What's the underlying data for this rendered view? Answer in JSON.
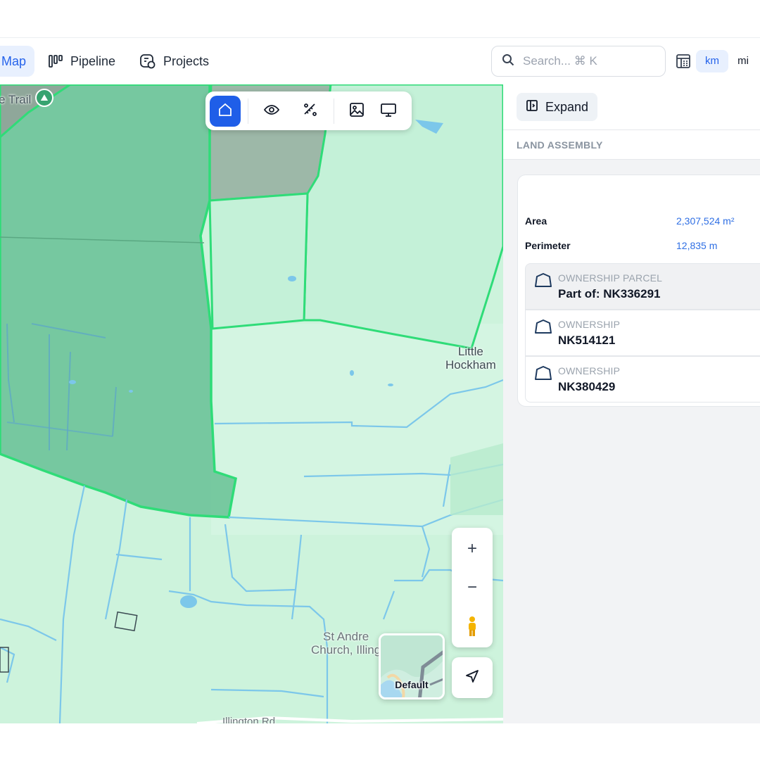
{
  "nav": {
    "items": [
      {
        "label": "Map",
        "icon": "map-icon",
        "active": true
      },
      {
        "label": "Pipeline",
        "icon": "pipeline-icon",
        "active": false
      },
      {
        "label": "Projects",
        "icon": "projects-icon",
        "active": false
      }
    ],
    "search": {
      "placeholder": "Search... ⌘ K",
      "value": ""
    },
    "units": {
      "km": "km",
      "mi": "mi",
      "active": "km"
    }
  },
  "map": {
    "labels": {
      "trail": "e Trail",
      "hockham": "Little\nHockham",
      "church": "St Andre\nChurch, Illing",
      "road": "Illington Rd"
    },
    "toolbar": [
      "home-icon",
      "eye-icon",
      "measure-icon",
      "image-icon",
      "monitor-icon"
    ],
    "zoom": {
      "in": "+",
      "out": "−"
    },
    "style_label": "Default"
  },
  "panel": {
    "expand_label": "Expand",
    "section_title": "LAND ASSEMBLY",
    "metrics": {
      "area_label": "Area",
      "area_value": "2,307,524 m²",
      "perimeter_label": "Perimeter",
      "perimeter_value": "12,835 m"
    },
    "parcels": [
      {
        "type": "OWNERSHIP PARCEL",
        "id": "Part of: NK336291",
        "selected": true
      },
      {
        "type": "OWNERSHIP",
        "id": "NK514121",
        "selected": false
      },
      {
        "type": "OWNERSHIP",
        "id": "NK380429",
        "selected": false
      }
    ]
  },
  "colors": {
    "accent": "#1f5ee8",
    "parcel_fill": "#6fc49a",
    "field_fill": "#c4f1d8",
    "boundary": "#2fdc78",
    "water": "#7cc7ea"
  }
}
